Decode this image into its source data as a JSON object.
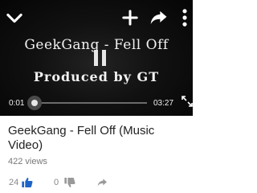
{
  "player": {
    "overlay_title": "GeekGang - Fell Off",
    "overlay_credit": "Produced by GT",
    "current_time": "0:01",
    "duration": "03:27",
    "progress_fraction": 0.01,
    "icons": {
      "collapse": "chevron-down-icon",
      "add": "add-to-playlist-icon",
      "share": "share-icon",
      "more": "more-vert-icon",
      "pause": "pause-icon",
      "fullscreen": "fullscreen-icon"
    }
  },
  "info": {
    "title": "GeekGang - Fell Off (Music Video)",
    "views": "422 views",
    "likes": "24",
    "dislikes": "0",
    "like_color": "#1e63c7"
  }
}
